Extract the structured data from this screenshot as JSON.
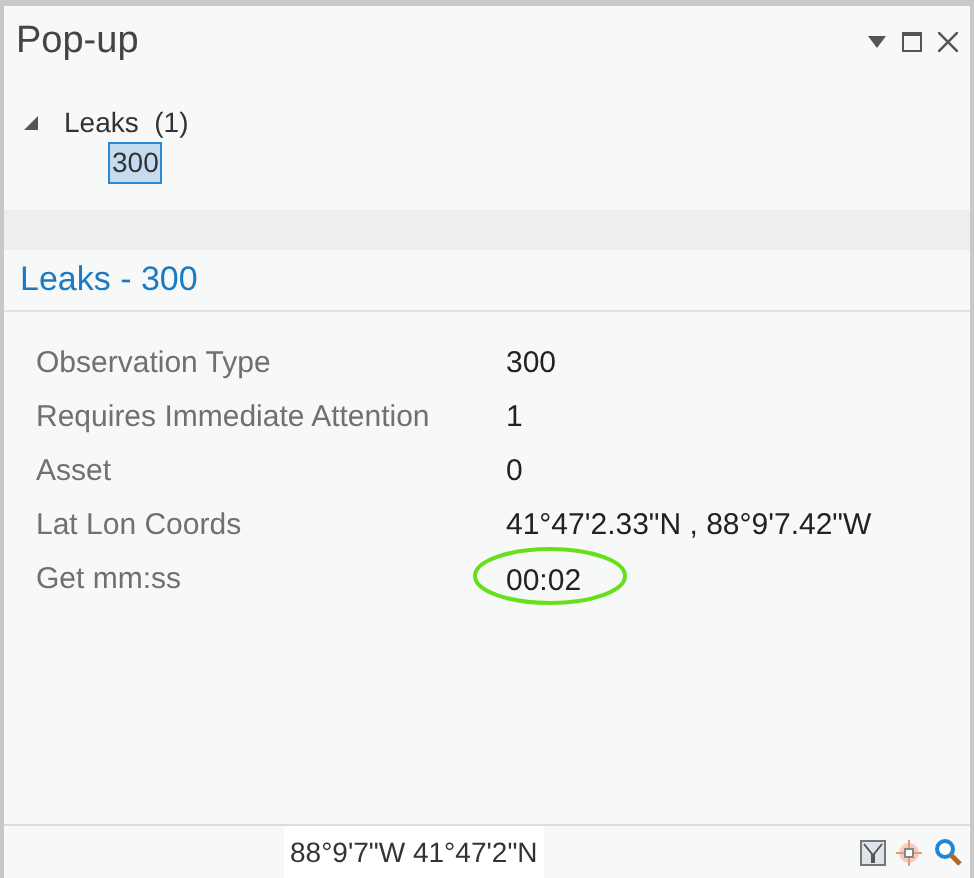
{
  "window": {
    "title": "Pop-up"
  },
  "tree": {
    "label": "Leaks",
    "count": "(1)",
    "expanded": true,
    "children": [
      {
        "label": "300",
        "selected": true
      }
    ]
  },
  "feature": {
    "title": "Leaks - 300"
  },
  "fields": [
    {
      "label": "Observation Type",
      "value": "300",
      "highlighted": false
    },
    {
      "label": "Requires Immediate Attention",
      "value": "1",
      "highlighted": false
    },
    {
      "label": "Asset",
      "value": "0",
      "highlighted": false
    },
    {
      "label": "Lat Lon Coords",
      "value": "41°47'2.33\"N , 88°9'7.42\"W",
      "highlighted": false
    },
    {
      "label": "Get mm:ss",
      "value": "00:02",
      "highlighted": true
    }
  ],
  "status_bar": {
    "coordinates": "88°9'7\"W 41°47'2\"N"
  }
}
